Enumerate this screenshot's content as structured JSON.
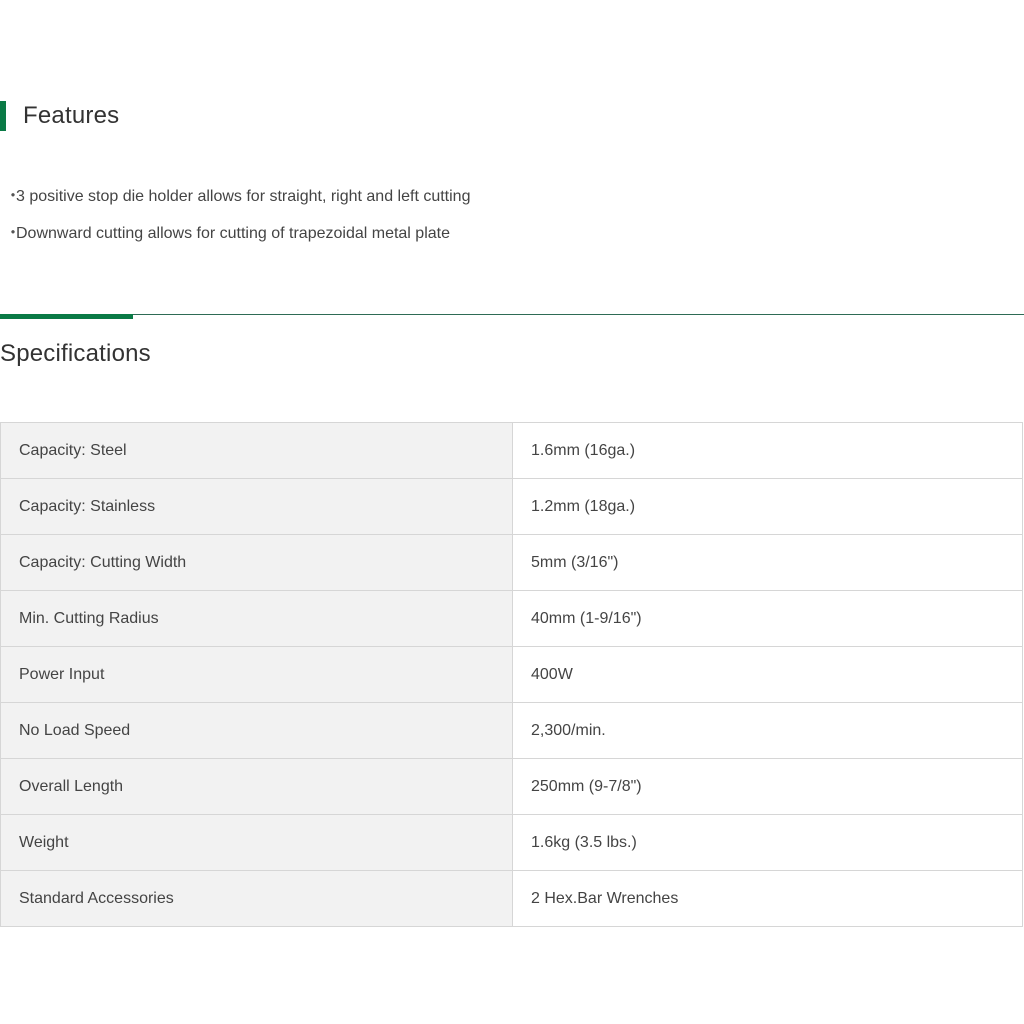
{
  "features": {
    "title": "Features",
    "bullet": "・",
    "items": [
      "3 positive stop die holder allows for straight, right and left cutting",
      "Downward cutting allows for cutting of trapezoidal metal plate"
    ]
  },
  "specifications": {
    "title": "Specifications",
    "rows": [
      {
        "label": "Capacity: Steel",
        "value": "1.6mm (16ga.)"
      },
      {
        "label": "Capacity: Stainless",
        "value": "1.2mm (18ga.)"
      },
      {
        "label": "Capacity: Cutting Width",
        "value": "5mm (3/16\")"
      },
      {
        "label": "Min. Cutting Radius",
        "value": "40mm (1-9/16\")"
      },
      {
        "label": "Power Input",
        "value": "400W"
      },
      {
        "label": "No Load Speed",
        "value": "2,300/min."
      },
      {
        "label": "Overall Length",
        "value": "250mm (9-7/8\")"
      },
      {
        "label": "Weight",
        "value": "1.6kg (3.5 lbs.)"
      },
      {
        "label": "Standard Accessories",
        "value": "2 Hex.Bar Wrenches"
      }
    ]
  },
  "colors": {
    "accent": "#0a7a46",
    "label_cell_bg": "#f2f2f2",
    "border": "#d6d6d6"
  }
}
